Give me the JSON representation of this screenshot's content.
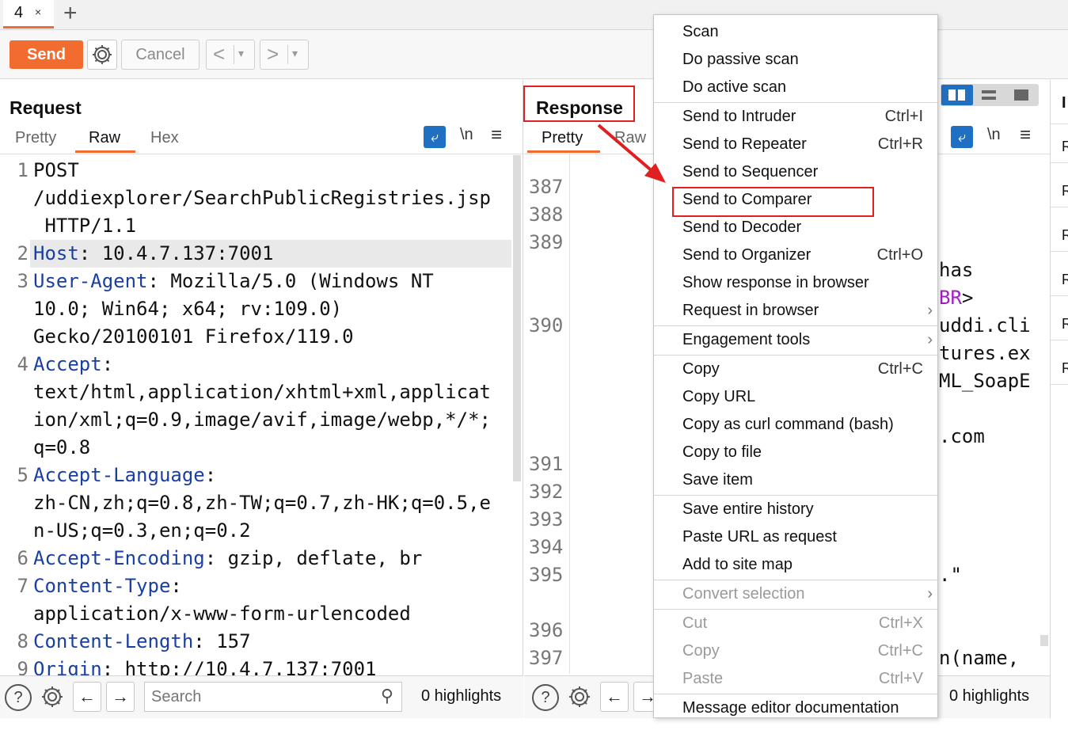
{
  "tabs": {
    "active_label": "4",
    "close_glyph": "×",
    "new_tab": "+"
  },
  "toolbar": {
    "send": "Send",
    "cancel": "Cancel",
    "back": "<",
    "forward": ">",
    "dropdown": "▾"
  },
  "request": {
    "title": "Request",
    "tabs": [
      "Pretty",
      "Raw",
      "Hex"
    ],
    "icons": {
      "newline": "\\n",
      "menu": "≡"
    },
    "lines": [
      {
        "n": "1",
        "parts": [
          [
            "POST",
            ""
          ]
        ]
      },
      {
        "n": "",
        "parts": [
          [
            "/uddiexplorer/SearchPublicRegistries.jsp",
            ""
          ]
        ]
      },
      {
        "n": "",
        "parts": [
          [
            " HTTP/1.1",
            ""
          ]
        ]
      },
      {
        "n": "2",
        "parts": [
          [
            "Host",
            "hdr"
          ],
          [
            ": 10.4.7.137:7001",
            ""
          ]
        ]
      },
      {
        "n": "3",
        "parts": [
          [
            "User-Agent",
            "hdr"
          ],
          [
            ": Mozilla/5.0 (Windows NT",
            ""
          ]
        ]
      },
      {
        "n": "",
        "parts": [
          [
            "10.0; Win64; x64; rv:109.0)",
            ""
          ]
        ]
      },
      {
        "n": "",
        "parts": [
          [
            "Gecko/20100101 Firefox/119.0",
            ""
          ]
        ]
      },
      {
        "n": "4",
        "parts": [
          [
            "Accept",
            "hdr"
          ],
          [
            ":",
            ""
          ]
        ]
      },
      {
        "n": "",
        "parts": [
          [
            "text/html,application/xhtml+xml,applicat",
            ""
          ]
        ]
      },
      {
        "n": "",
        "parts": [
          [
            "ion/xml;q=0.9,image/avif,image/webp,*/*;",
            ""
          ]
        ]
      },
      {
        "n": "",
        "parts": [
          [
            "q=0.8",
            ""
          ]
        ]
      },
      {
        "n": "5",
        "parts": [
          [
            "Accept-Language",
            "hdr"
          ],
          [
            ":",
            ""
          ]
        ]
      },
      {
        "n": "",
        "parts": [
          [
            "zh-CN,zh;q=0.8,zh-TW;q=0.7,zh-HK;q=0.5,e",
            ""
          ]
        ]
      },
      {
        "n": "",
        "parts": [
          [
            "n-US;q=0.3,en;q=0.2",
            ""
          ]
        ]
      },
      {
        "n": "6",
        "parts": [
          [
            "Accept-Encoding",
            "hdr"
          ],
          [
            ": gzip, deflate, br",
            ""
          ]
        ]
      },
      {
        "n": "7",
        "parts": [
          [
            "Content-Type",
            "hdr"
          ],
          [
            ":",
            ""
          ]
        ]
      },
      {
        "n": "",
        "parts": [
          [
            "application/x-www-form-urlencoded",
            ""
          ]
        ]
      },
      {
        "n": "8",
        "parts": [
          [
            "Content-Length",
            "hdr"
          ],
          [
            ": 157",
            ""
          ]
        ]
      },
      {
        "n": "9",
        "parts": [
          [
            "Origin",
            "hdr"
          ],
          [
            ": http://10.4.7.137:7001",
            ""
          ]
        ]
      }
    ],
    "search_placeholder": "Search",
    "highlights": "0 highlights"
  },
  "response": {
    "title": "Response",
    "tabs": [
      "Pretty",
      "Raw"
    ],
    "line_numbers": [
      {
        "n": "387",
        "row": 0
      },
      {
        "n": "388",
        "row": 1
      },
      {
        "n": "389",
        "row": 2
      },
      {
        "n": "390",
        "row": 5
      },
      {
        "n": "391",
        "row": 10
      },
      {
        "n": "392",
        "row": 11
      },
      {
        "n": "393",
        "row": 12
      },
      {
        "n": "394",
        "row": 13
      },
      {
        "n": "395",
        "row": 14
      },
      {
        "n": "396",
        "row": 16
      },
      {
        "n": "397",
        "row": 17
      }
    ],
    "visible_fragments": [
      {
        "text": "has",
        "row": 3,
        "color": "#111"
      },
      {
        "text": "BR",
        "row": 4,
        "color": "#a020c0"
      },
      {
        "text": ">",
        "row": 4,
        "color": "#111",
        "after": true
      },
      {
        "text": "uddi.cli",
        "row": 5,
        "color": "#111"
      },
      {
        "text": "tures.ex",
        "row": 6,
        "color": "#111"
      },
      {
        "text": "ML_SoapE",
        "row": 7,
        "color": "#111"
      },
      {
        "text": ".com",
        "row": 9,
        "color": "#111"
      },
      {
        "text": ".\"",
        "row": 14,
        "color": "#111"
      },
      {
        "text": "n(name,",
        "row": 17,
        "color": "#111"
      }
    ],
    "highlights": "0 highlights"
  },
  "inspector": {
    "header": "I",
    "rows": [
      "R",
      "R",
      "R",
      "R",
      "R",
      "R"
    ]
  },
  "context_menu": {
    "groups": [
      [
        {
          "label": "Scan"
        },
        {
          "label": "Do passive scan"
        },
        {
          "label": "Do active scan"
        }
      ],
      [
        {
          "label": "Send to Intruder",
          "shortcut": "Ctrl+I"
        },
        {
          "label": "Send to Repeater",
          "shortcut": "Ctrl+R"
        },
        {
          "label": "Send to Sequencer"
        },
        {
          "label": "Send to Comparer",
          "highlighted": true
        },
        {
          "label": "Send to Decoder"
        },
        {
          "label": "Send to Organizer",
          "shortcut": "Ctrl+O"
        },
        {
          "label": "Show response in browser"
        },
        {
          "label": "Request in browser",
          "submenu": true
        }
      ],
      [
        {
          "label": "Engagement tools",
          "submenu": true
        }
      ],
      [
        {
          "label": "Copy",
          "shortcut": "Ctrl+C"
        },
        {
          "label": "Copy URL"
        },
        {
          "label": "Copy as curl command (bash)"
        },
        {
          "label": "Copy to file"
        },
        {
          "label": "Save item"
        }
      ],
      [
        {
          "label": "Save entire history"
        },
        {
          "label": "Paste URL as request"
        },
        {
          "label": "Add to site map"
        }
      ],
      [
        {
          "label": "Convert selection",
          "submenu": true,
          "disabled": true
        }
      ],
      [
        {
          "label": "Cut",
          "shortcut": "Ctrl+X",
          "disabled": true
        },
        {
          "label": "Copy",
          "shortcut": "Ctrl+C",
          "disabled": true
        },
        {
          "label": "Paste",
          "shortcut": "Ctrl+V",
          "disabled": true
        }
      ],
      [
        {
          "label": "Message editor documentation"
        }
      ]
    ]
  },
  "colors": {
    "accent": "#f26b2f",
    "header_key": "#1a3fa3",
    "annotation": "#e02020",
    "wrap_icon": "#1f6fc2"
  }
}
